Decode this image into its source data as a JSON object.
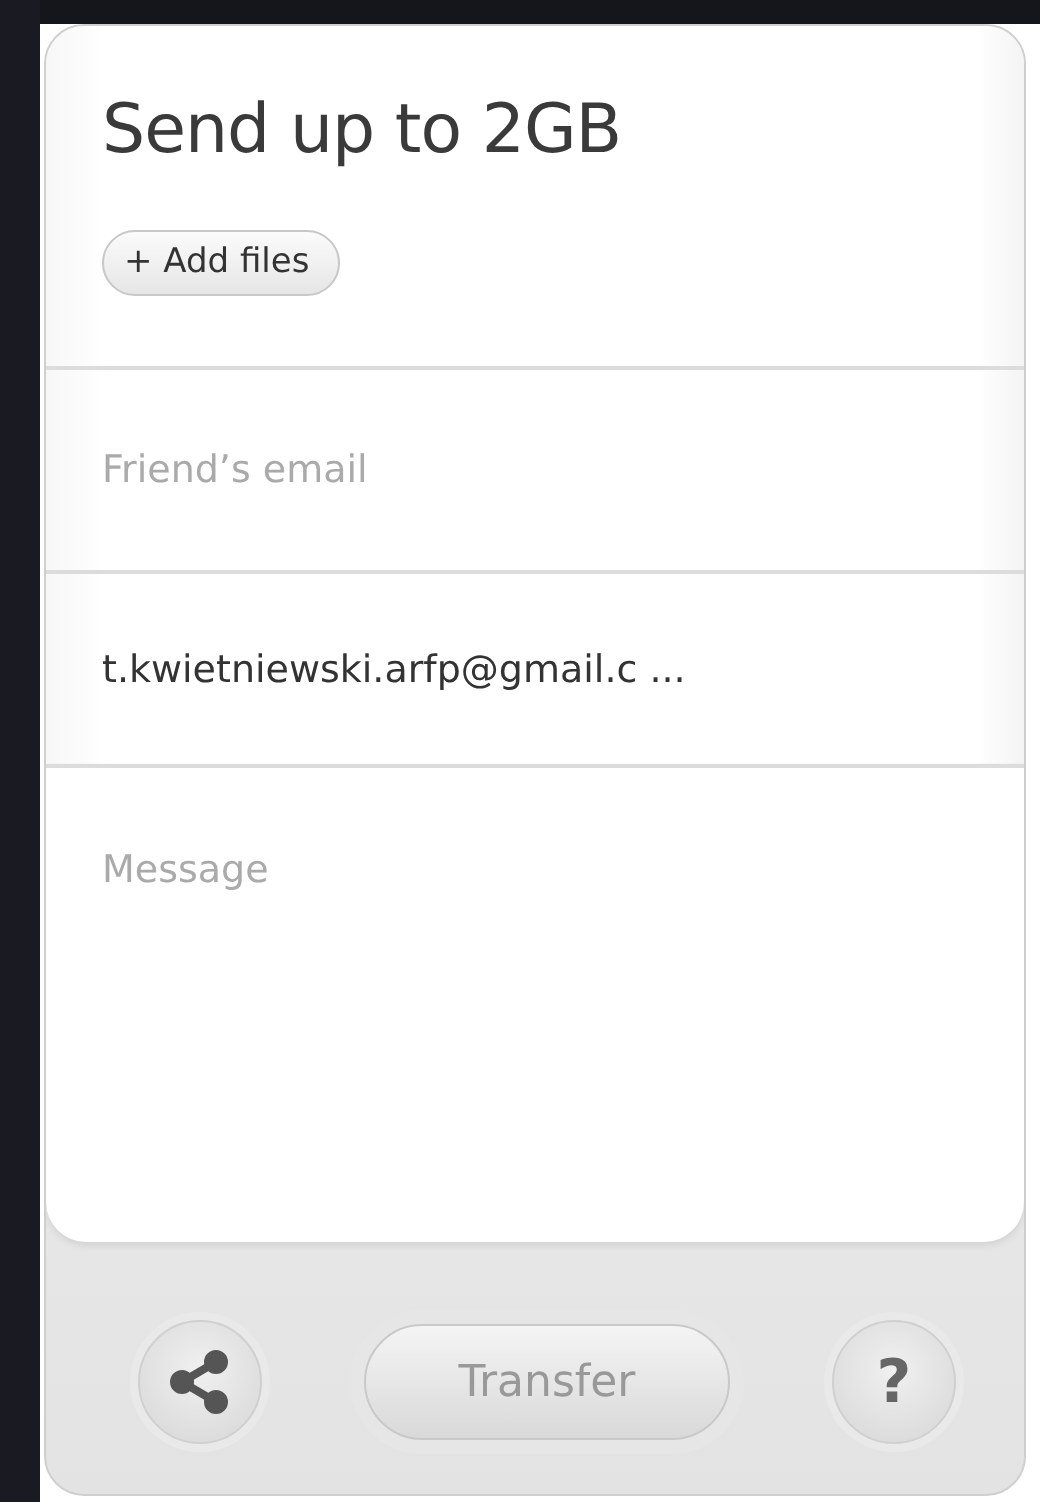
{
  "title": "Send up to 2GB",
  "add_files": {
    "label": "+ Add files"
  },
  "fields": [
    {
      "kind": "input",
      "placeholder": "Friend’s email"
    },
    {
      "kind": "input",
      "value": "t.kwietniewski.arfp@gmail.c ..."
    },
    {
      "kind": "textarea",
      "placeholder": "Message"
    }
  ],
  "footer": {
    "transfer": {
      "label": "Transfer",
      "disabled": true
    },
    "help": {
      "label": "?"
    }
  }
}
